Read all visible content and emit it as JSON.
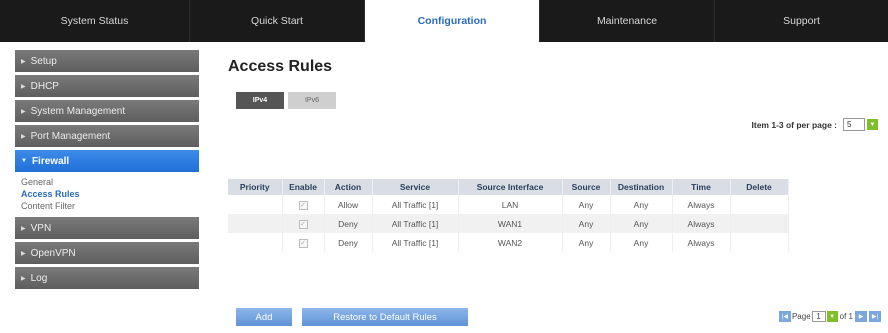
{
  "topnav": {
    "tabs": [
      {
        "label": "System Status"
      },
      {
        "label": "Quick Start"
      },
      {
        "label": "Configuration"
      },
      {
        "label": "Maintenance"
      },
      {
        "label": "Support"
      }
    ]
  },
  "sidebar": {
    "items": [
      {
        "label": "Setup"
      },
      {
        "label": "DHCP"
      },
      {
        "label": "System Management"
      },
      {
        "label": "Port Management"
      },
      {
        "label": "Firewall"
      },
      {
        "label": "VPN"
      },
      {
        "label": "OpenVPN"
      },
      {
        "label": "Log"
      }
    ],
    "firewall_sub": [
      "General",
      "Access Rules",
      "Content Filter"
    ]
  },
  "main": {
    "title": "Access Rules",
    "subtabs": [
      "IPv4",
      "IPv6"
    ],
    "pager_top": {
      "label": "Item 1-3 of per page :",
      "per_page": "5"
    },
    "table": {
      "headers": [
        "Priority",
        "Enable",
        "Action",
        "Service",
        "Source Interface",
        "Source",
        "Destination",
        "Time",
        "Delete"
      ],
      "rows": [
        {
          "enable": "✓",
          "action": "Allow",
          "service": "All Traffic [1]",
          "source_interface": "LAN",
          "source": "Any",
          "destination": "Any",
          "time": "Always"
        },
        {
          "enable": "✓",
          "action": "Deny",
          "service": "All Traffic [1]",
          "source_interface": "WAN1",
          "source": "Any",
          "destination": "Any",
          "time": "Always"
        },
        {
          "enable": "✓",
          "action": "Deny",
          "service": "All Traffic [1]",
          "source_interface": "WAN2",
          "source": "Any",
          "destination": "Any",
          "time": "Always"
        }
      ]
    },
    "buttons": {
      "add": "Add",
      "restore": "Restore to Default Rules"
    },
    "pager_bottom": {
      "page_word": "Page",
      "page": "1",
      "of_label": "of 1"
    }
  },
  "colors": {
    "accent": "#2a6bbd",
    "active_sidebar": "#1f6fd8",
    "allow": "#3a9a1a",
    "deny": "#c0392b"
  }
}
